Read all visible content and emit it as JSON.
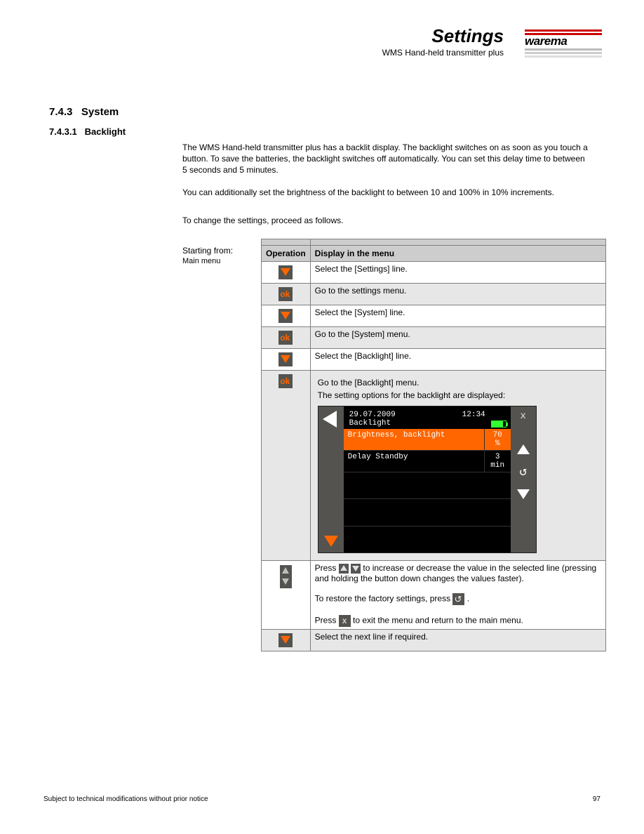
{
  "header": {
    "title": "Settings",
    "subtitle": "WMS Hand-held transmitter plus",
    "brand": "warema"
  },
  "section": {
    "number": "7.4.3",
    "title": "System",
    "sub_number": "7.4.3.1",
    "sub_title": "Backlight"
  },
  "intro": {
    "p1": "The WMS Hand-held transmitter plus has a backlit display. The backlight switches on as soon as you touch a button. To save the batteries, the backlight switches off automatically. You can set this delay time to between 5 seconds and 5 minutes.",
    "p2": "You can additionally set the brightness of the backlight to between 10 and 100% in 10% increments.",
    "p3": "To change the settings, proceed as follows."
  },
  "start_label": "Starting from:",
  "start_from": "Main menu",
  "table": {
    "hdr_operation": "Operation",
    "hdr_display": "Display in the menu",
    "r1": "Select the [Settings] line.",
    "r2": "Go to the settings menu.",
    "r3": "Select the [System] line.",
    "r4": "Go to the [System] menu.",
    "r5": "Select the [Backlight] line.",
    "r6": "Go to the [Backlight] menu.",
    "r6_hint": "The setting options for the backlight are displayed:",
    "r7a_pre": "Press ",
    "r7a_post": " to increase or decrease the value in the selected line (pressing and holding the button down changes the values faster).",
    "r7b_pre": "To restore the factory settings, press ",
    "r7b_post": ".",
    "r7c_pre": "Press ",
    "r7c_post": " to exit the menu and return to the main menu.",
    "r8": "Select the next line if required."
  },
  "device": {
    "date": "29.07.2009",
    "time": "12:34",
    "screen_title": "Backlight",
    "row1_label": "Brightness, backlight",
    "row1_val": "70",
    "row1_unit": "%",
    "row2_label": "Delay Standby",
    "row2_val": "3",
    "row2_unit": "min"
  },
  "footer": {
    "left": "Subject to technical modifications without prior notice",
    "right": "97"
  }
}
